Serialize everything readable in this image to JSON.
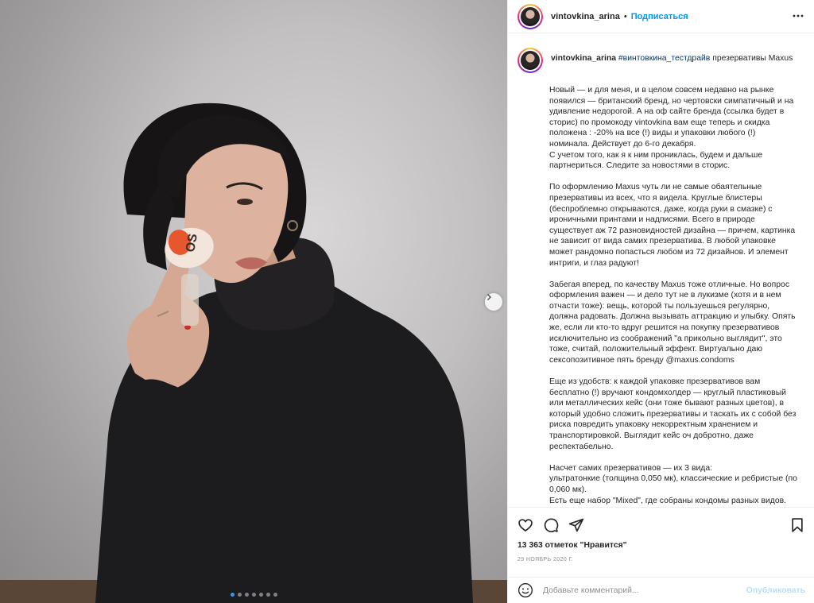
{
  "post": {
    "username": "vintovkina_arina",
    "separator": "•",
    "follow_label": "Подписаться",
    "more_icon": "more-horizontal-icon"
  },
  "caption": {
    "username": "vintovkina_arina",
    "hashtag": "#винтовкина_тестдрайв",
    "title_rest": " презервативы Maxus",
    "paragraphs": [
      [
        "Новый — и для меня, и в целом совсем недавно на рынке",
        "появился — британский бренд, но чертовски симпатичный и на",
        "удивление недорогой. А на оф сайте бренда (ссылка будет в",
        "сторис) по промокоду vintovkina вам еще теперь и скидка",
        "положена : -20% на все (!) виды и упаковки любого (!)",
        "номинала. Действует до 6-го декабря.",
        "С учетом того, как я к ним прониклась, будем и дальше",
        "партнериться. Следите за новостями в сторис."
      ],
      [
        "По оформлению Maxus чуть ли не самые обаятельные",
        "презервативы из всех, что я видела. Круглые блистеры",
        "(беспроблемно открываются, даже, когда руки в смазке) с",
        "ироничными принтами и надписями. Всего в природе",
        "существует аж 72 разновидностей дизайна — причем, картинка",
        "не зависит от вида самих презерватива. В любой упаковке",
        "может рандомно попасться любом из 72 дизайнов. И элемент",
        "интриги, и глаз радуют!"
      ],
      [
        "Забегая вперед, по качеству Maxus тоже отличные. Но вопрос",
        "оформления важен — и дело тут не в лукизме (хотя и в нем",
        "отчасти тоже): вещь, которой ты пользуешься регулярно,",
        "должна радовать. Должна вызывать аттракцию и улыбку. Опять",
        "же, если ли кто-то вдруг решится на покупку презервативов",
        "исключительно из соображений \"а прикольно выглядит\", это",
        "тоже, считай, положительный эффект. Виртуально даю"
      ],
      [
        "Еще из удобств: к каждой упаковке презервативов вам",
        "бесплатно (!) вручают кондомхолдер — круглый пластиковый",
        "или металлических кейс (они тоже бывают разных цветов), в",
        "который удобно сложить презервативы и таскать их с собой без",
        "риска повредить упаковку некорректным хранением и",
        "транспортировкой. Выглядит кейс оч добротно, даже",
        "респектабельно."
      ],
      [
        "Насчет самих презервативов — их 3 вида:",
        "ультратонкие (толщина 0,050 мк), классические и ребристые (по",
        "0,060 мк).",
        "Есть еще набор \"Mixed\", где собраны кондомы разных видов."
      ]
    ],
    "para3_last_prefix": "сексопозитивное пять бренду ",
    "para3_mention": "@maxus.condoms"
  },
  "actions": {
    "like_icon": "heart-icon",
    "comment_icon": "comment-icon",
    "share_icon": "share-icon",
    "save_icon": "bookmark-icon"
  },
  "likes_text": "13 363 отметок \"Нравится\"",
  "date_text": "29 НОЯБРЬ 2020 Г.",
  "comment": {
    "emoji_icon": "emoji-icon",
    "placeholder": "Добавьте комментарий...",
    "value": "",
    "publish_label": "Опубликовать"
  },
  "carousel": {
    "next_icon": "chevron-right-icon",
    "total_slides": 7,
    "active_slide": 1
  },
  "colors": {
    "link": "#00376b",
    "follow": "#0095f6",
    "publish_disabled": "#b2dffc",
    "active_dot": "#3897f0"
  }
}
